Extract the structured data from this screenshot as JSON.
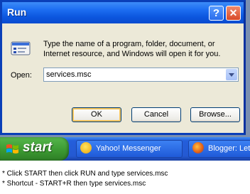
{
  "dialog": {
    "title": "Run",
    "help_glyph": "?",
    "close_glyph": "✕",
    "description": "Type the name of a program, folder, document, or Internet resource, and Windows will open it for you.",
    "open_label": "Open:",
    "open_value": "services.msc",
    "buttons": {
      "ok": "OK",
      "cancel": "Cancel",
      "browse": "Browse..."
    }
  },
  "taskbar": {
    "start_label": "start",
    "tasks": [
      {
        "label": "Yahoo! Messenger",
        "icon": "yahoo-messenger-icon"
      },
      {
        "label": "Blogger: Let",
        "icon": "firefox-icon"
      }
    ]
  },
  "captions": [
    "* Click START then click RUN and type services.msc",
    "* Shortcut - START+R then type services.msc"
  ]
}
